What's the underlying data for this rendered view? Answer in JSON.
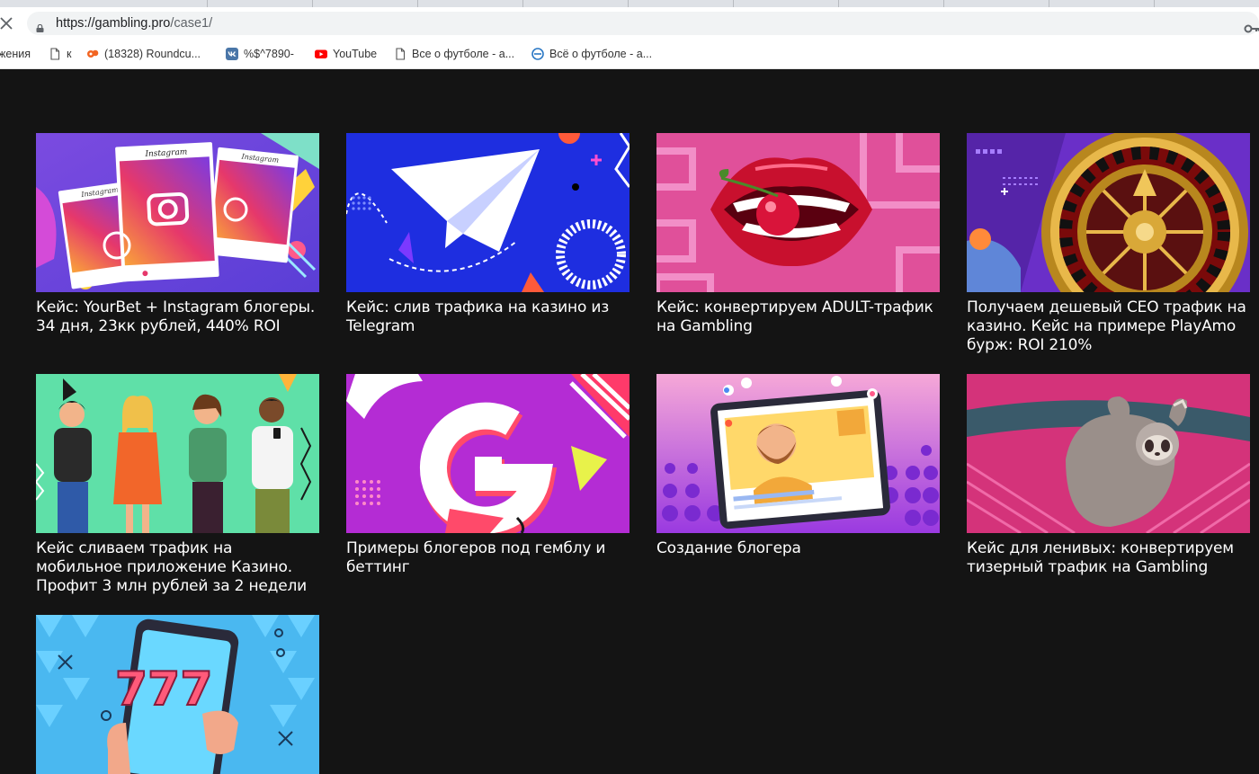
{
  "browser": {
    "url_host": "https://gambling.pro",
    "url_path": "/case1/",
    "bookmarks": [
      {
        "label": "жения",
        "icon": "none"
      },
      {
        "label": "к",
        "icon": "page-icon"
      },
      {
        "label": "(18328) Roundcu...",
        "icon": "roundcube-icon"
      },
      {
        "label": "%$^7890-",
        "icon": "vk-icon"
      },
      {
        "label": "YouTube",
        "icon": "youtube-icon"
      },
      {
        "label": "Все о футболе - а...",
        "icon": "page-icon"
      },
      {
        "label": "Всё о футболе - а...",
        "icon": "globe-icon"
      }
    ]
  },
  "cards": [
    {
      "title": "Кейс: YourBet + Instagram блогеры. 34 дня, 23кк рублей, 440% ROI",
      "image": "instagram-image",
      "thumb_labels": [
        "Instagram",
        "Instagram",
        "Instagram"
      ]
    },
    {
      "title": "Кейс: слив трафика на казино из Telegram",
      "image": "telegram-image"
    },
    {
      "title": "Кейс: конвертируем ADULT-трафик на Gambling",
      "image": "lips-cherry-image"
    },
    {
      "title": "Получаем дешевый CEO трафик на казино. Кейс на примере PlayAmo бурж: ROI 210%",
      "image": "roulette-image"
    },
    {
      "title": "Кейс сливаем трафик на мобильное приложение Казино. Профит 3 млн рублей за 2 недели",
      "image": "people-phones-image"
    },
    {
      "title": "Примеры блогеров под гемблу и беттинг",
      "image": "g-logo-image"
    },
    {
      "title": "Создание блогера",
      "image": "blogger-tablet-image"
    },
    {
      "title": "Кейс для ленивых: конвертируем тизерный трафик на Gambling",
      "image": "sloth-image"
    },
    {
      "title": "",
      "image": "slot-777-phone-image",
      "thumb_labels": [
        "777"
      ]
    }
  ],
  "colors": {
    "page_background": "#141414",
    "caption_text": "#ffffff"
  }
}
